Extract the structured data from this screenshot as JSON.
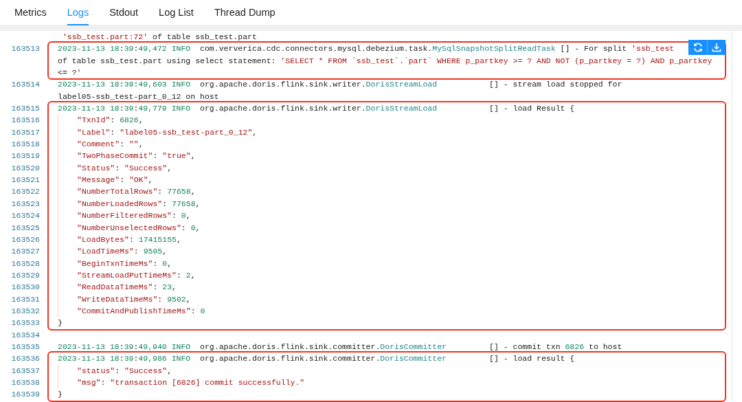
{
  "tabs": [
    {
      "label": "Metrics",
      "selected": false
    },
    {
      "label": "Logs",
      "selected": true
    },
    {
      "label": "Stdout",
      "selected": false
    },
    {
      "label": "Log List",
      "selected": false
    },
    {
      "label": "Thread Dump",
      "selected": false
    }
  ],
  "log_blocks": [
    {
      "highlighted": false,
      "lines": [
        {
          "indent": false,
          "rows": [
            " 'ssb_test.part:72' of table ssb_test.part"
          ]
        }
      ]
    },
    {
      "highlighted": true,
      "lines": [
        {
          "number": "163513",
          "indent": false,
          "rows": [
            "2023-11-13 18:39:49,472 INFO  com.ververica.cdc.connectors.mysql.debezium.task.MySqlSnapshotSplitReadTask [] - For split 'ssb_test",
            "of table ssb_test.part using select statement: 'SELECT * FROM `ssb_test`.`part` WHERE p_partkey >= ? AND NOT (p_partkey = ?) AND p_partkey",
            "<= ?'"
          ]
        }
      ]
    },
    {
      "highlighted": false,
      "lines": [
        {
          "number": "163514",
          "indent": false,
          "rows": [
            "2023-11-13 18:39:49,603 INFO  org.apache.doris.flink.sink.writer.DorisStreamLoad           [] - stream load stopped for",
            "label05-ssb_test-part_0_12 on host"
          ]
        }
      ]
    },
    {
      "highlighted": true,
      "lines": [
        {
          "number": "163515",
          "indent": false,
          "rows": [
            "2023-11-13 18:39:49,779 INFO  org.apache.doris.flink.sink.writer.DorisStreamLoad           [] - load Result {"
          ]
        },
        {
          "number": "163516",
          "indent": true,
          "rows": [
            "\"TxnId\": 6826,"
          ]
        },
        {
          "number": "163517",
          "indent": true,
          "rows": [
            "\"Label\": \"label05-ssb_test-part_0_12\","
          ]
        },
        {
          "number": "163518",
          "indent": true,
          "rows": [
            "\"Comment\": \"\","
          ]
        },
        {
          "number": "163519",
          "indent": true,
          "rows": [
            "\"TwoPhaseCommit\": \"true\","
          ]
        },
        {
          "number": "163520",
          "indent": true,
          "rows": [
            "\"Status\": \"Success\","
          ]
        },
        {
          "number": "163521",
          "indent": true,
          "rows": [
            "\"Message\": \"OK\","
          ]
        },
        {
          "number": "163522",
          "indent": true,
          "rows": [
            "\"NumberTotalRows\": 77658,"
          ]
        },
        {
          "number": "163523",
          "indent": true,
          "rows": [
            "\"NumberLoadedRows\": 77658,"
          ]
        },
        {
          "number": "163524",
          "indent": true,
          "rows": [
            "\"NumberFilteredRows\": 0,"
          ]
        },
        {
          "number": "163525",
          "indent": true,
          "rows": [
            "\"NumberUnselectedRows\": 0,"
          ]
        },
        {
          "number": "163526",
          "indent": true,
          "rows": [
            "\"LoadBytes\": 17415155,"
          ]
        },
        {
          "number": "163527",
          "indent": true,
          "rows": [
            "\"LoadTimeMs\": 9505,"
          ]
        },
        {
          "number": "163528",
          "indent": true,
          "rows": [
            "\"BeginTxnTimeMs\": 0,"
          ]
        },
        {
          "number": "163529",
          "indent": true,
          "rows": [
            "\"StreamLoadPutTimeMs\": 2,"
          ]
        },
        {
          "number": "163530",
          "indent": true,
          "rows": [
            "\"ReadDataTimeMs\": 23,"
          ]
        },
        {
          "number": "163531",
          "indent": true,
          "rows": [
            "\"WriteDataTimeMs\": 9502,"
          ]
        },
        {
          "number": "163532",
          "indent": true,
          "rows": [
            "\"CommitAndPublishTimeMs\": 0"
          ]
        },
        {
          "number": "163533",
          "indent": false,
          "rows": [
            "}"
          ]
        }
      ]
    },
    {
      "highlighted": false,
      "lines": [
        {
          "number": "163534"
        },
        {
          "number": "163535",
          "indent": false,
          "rows": [
            "2023-11-13 18:39:49,940 INFO  org.apache.doris.flink.sink.committer.DorisCommitter         [] - commit txn 6826 to host"
          ]
        }
      ]
    },
    {
      "highlighted": true,
      "lines": [
        {
          "number": "163536",
          "indent": false,
          "rows": [
            "2023-11-13 18:39:49,986 INFO  org.apache.doris.flink.sink.committer.DorisCommitter         [] - load result {"
          ]
        },
        {
          "number": "163537",
          "indent": true,
          "rows": [
            "\"status\": \"Success\","
          ]
        },
        {
          "number": "163538",
          "indent": true,
          "rows": [
            "\"msg\": \"transaction [6826] commit successfully.\""
          ]
        },
        {
          "number": "163539",
          "indent": false,
          "rows": [
            "}"
          ]
        }
      ]
    }
  ]
}
